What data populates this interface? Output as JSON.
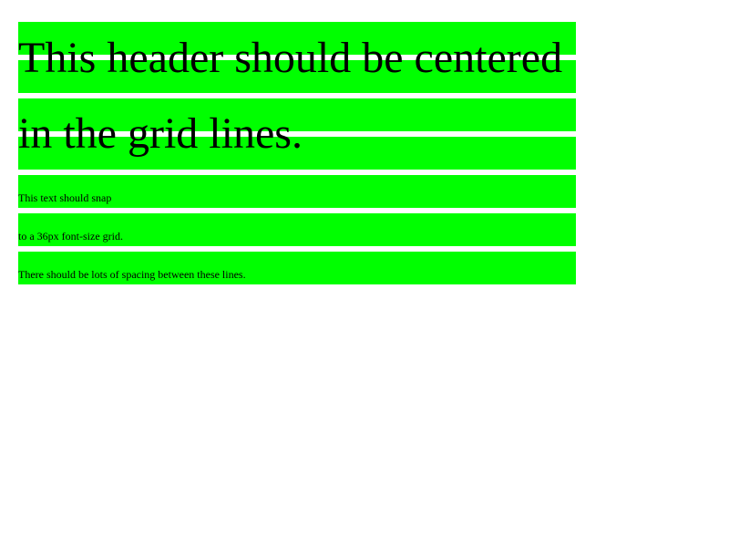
{
  "header": {
    "line1": "This header should be centered",
    "line2": "in the grid lines."
  },
  "body": {
    "line1": "This text should snap",
    "line2": "to a 36px font-size grid.",
    "line3": "There should be lots of spacing between these lines."
  },
  "colors": {
    "grid_band": "#00ff00",
    "background": "#ffffff",
    "text": "#000000"
  }
}
